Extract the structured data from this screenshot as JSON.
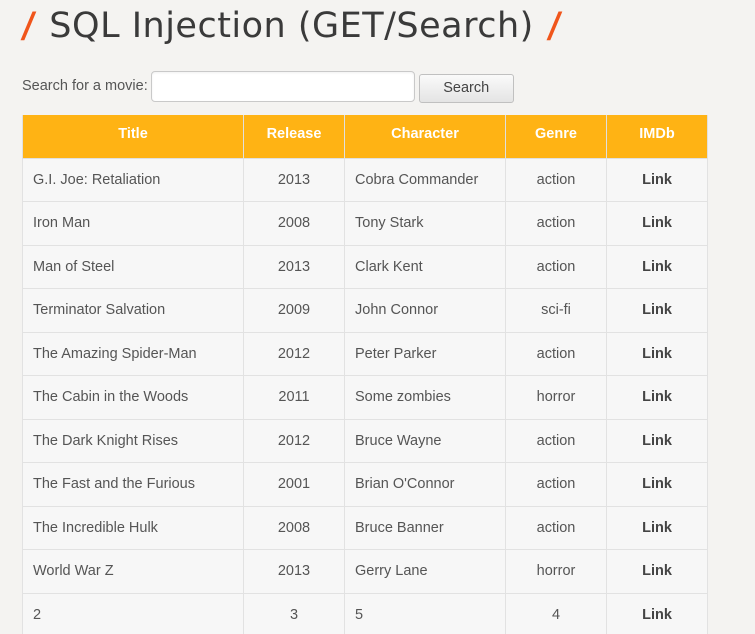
{
  "page": {
    "title": "SQL Injection (GET/Search)",
    "slash": "/"
  },
  "search": {
    "label": "Search for a movie:",
    "value": "",
    "placeholder": "",
    "button_label": "Search"
  },
  "table": {
    "headers": {
      "title": "Title",
      "release": "Release",
      "character": "Character",
      "genre": "Genre",
      "imdb": "IMDb"
    },
    "rows": [
      {
        "title": "G.I. Joe: Retaliation",
        "release": "2013",
        "character": "Cobra Commander",
        "genre": "action",
        "imdb": "Link"
      },
      {
        "title": "Iron Man",
        "release": "2008",
        "character": "Tony Stark",
        "genre": "action",
        "imdb": "Link"
      },
      {
        "title": "Man of Steel",
        "release": "2013",
        "character": "Clark Kent",
        "genre": "action",
        "imdb": "Link"
      },
      {
        "title": "Terminator Salvation",
        "release": "2009",
        "character": "John Connor",
        "genre": "sci-fi",
        "imdb": "Link"
      },
      {
        "title": "The Amazing Spider-Man",
        "release": "2012",
        "character": "Peter Parker",
        "genre": "action",
        "imdb": "Link"
      },
      {
        "title": "The Cabin in the Woods",
        "release": "2011",
        "character": "Some zombies",
        "genre": "horror",
        "imdb": "Link"
      },
      {
        "title": "The Dark Knight Rises",
        "release": "2012",
        "character": "Bruce Wayne",
        "genre": "action",
        "imdb": "Link"
      },
      {
        "title": "The Fast and the Furious",
        "release": "2001",
        "character": "Brian O'Connor",
        "genre": "action",
        "imdb": "Link"
      },
      {
        "title": "The Incredible Hulk",
        "release": "2008",
        "character": "Bruce Banner",
        "genre": "action",
        "imdb": "Link"
      },
      {
        "title": "World War Z",
        "release": "2013",
        "character": "Gerry Lane",
        "genre": "horror",
        "imdb": "Link"
      },
      {
        "title": "2",
        "release": "3",
        "character": "5",
        "genre": "4",
        "imdb": "Link"
      }
    ]
  },
  "colors": {
    "accent": "#f0551b",
    "header_bg": "#ffb314",
    "header_text": "#ffffff"
  }
}
